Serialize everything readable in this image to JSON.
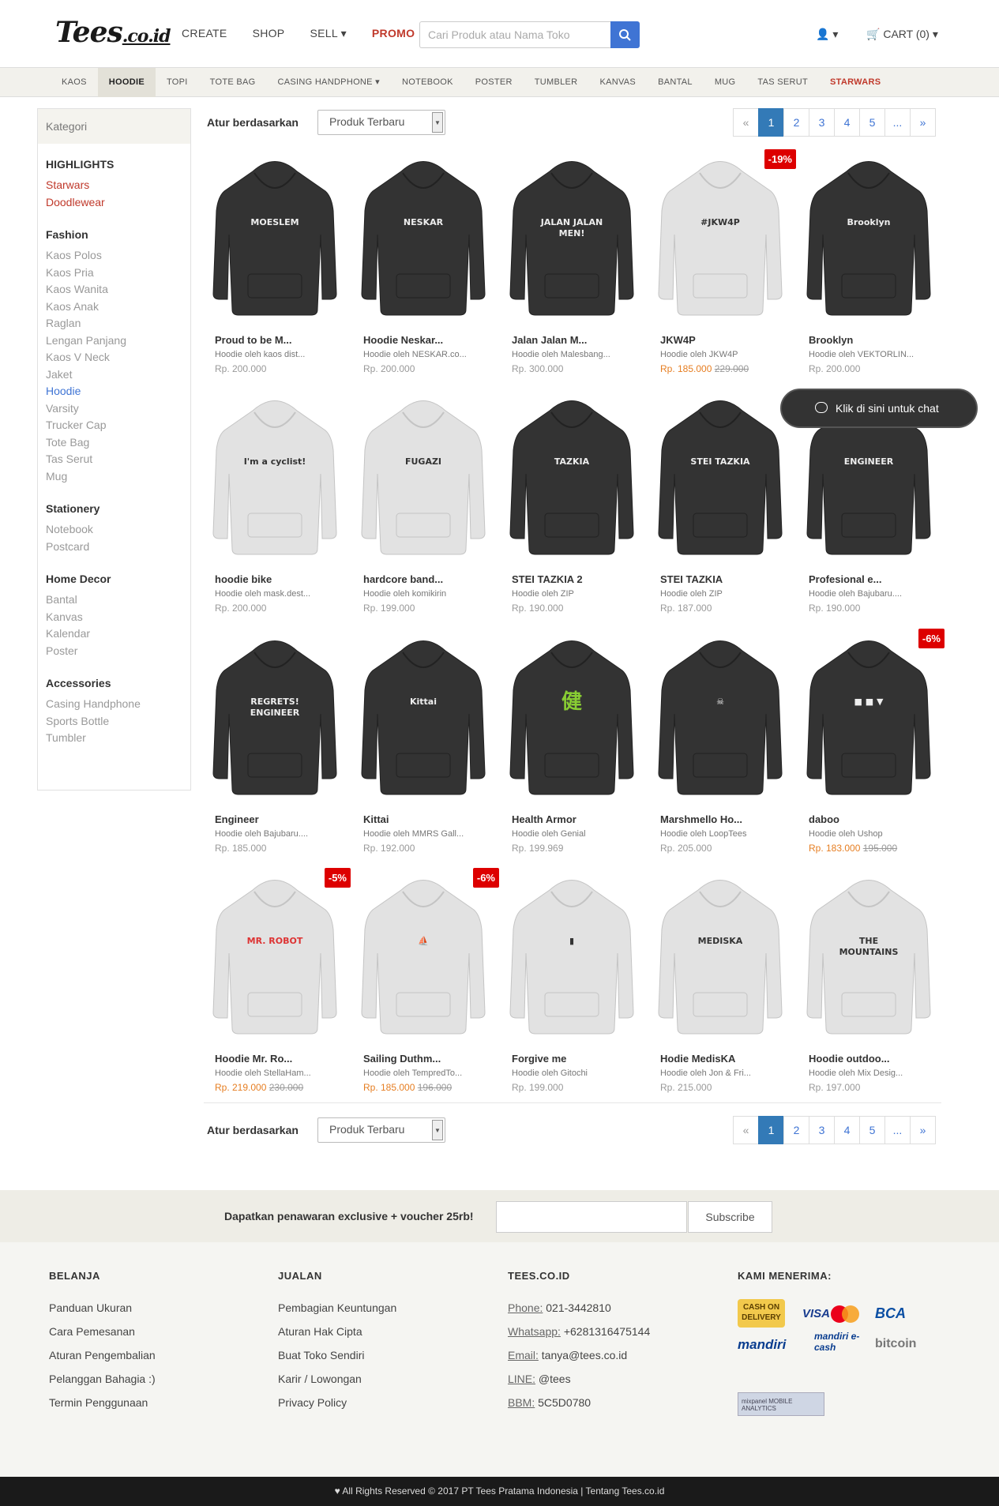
{
  "header": {
    "logo": "Tees",
    "logo_suffix": ".co.id",
    "nav": [
      "CREATE",
      "SHOP",
      "SELL",
      "PROMO"
    ],
    "search_placeholder": "Cari Produk atau Nama Toko",
    "cart": "CART (0)"
  },
  "subnav": [
    "KAOS",
    "HOODIE",
    "TOPI",
    "TOTE BAG",
    "CASING HANDPHONE",
    "NOTEBOOK",
    "POSTER",
    "TUMBLER",
    "KANVAS",
    "BANTAL",
    "MUG",
    "TAS SERUT",
    "STARWARS"
  ],
  "sidebar": {
    "title": "Kategori",
    "groups": [
      {
        "name": "HIGHLIGHTS",
        "items": [
          "Starwars",
          "Doodlewear"
        ]
      },
      {
        "name": "Fashion",
        "items": [
          "Kaos Polos",
          "Kaos Pria",
          "Kaos Wanita",
          "Kaos Anak",
          "Raglan",
          "Lengan Panjang",
          "Kaos V Neck",
          "Jaket",
          "Hoodie",
          "Varsity",
          "Trucker Cap",
          "Tote Bag",
          "Tas Serut",
          "Mug"
        ]
      },
      {
        "name": "Stationery",
        "items": [
          "Notebook",
          "Postcard"
        ]
      },
      {
        "name": "Home Decor",
        "items": [
          "Bantal",
          "Kanvas",
          "Kalendar",
          "Poster"
        ]
      },
      {
        "name": "Accessories",
        "items": [
          "Casing Handphone",
          "Sports Bottle",
          "Tumbler"
        ]
      }
    ]
  },
  "sort": {
    "label": "Atur berdasarkan",
    "value": "Produk Terbaru"
  },
  "pagination": [
    "«",
    "1",
    "2",
    "3",
    "4",
    "5",
    "...",
    "»"
  ],
  "chat": "Klik di sini untuk chat",
  "products": [
    {
      "name": "Proud to be M...",
      "seller": "Hoodie oleh kaos dist...",
      "price": "Rp. 200.000",
      "old": "",
      "badge": "",
      "color": "dark",
      "print": "MOESLEM"
    },
    {
      "name": "Hoodie Neskar...",
      "seller": "Hoodie oleh NESKAR.co...",
      "price": "Rp. 200.000",
      "old": "",
      "badge": "",
      "color": "dark",
      "print": "NESKAR"
    },
    {
      "name": "Jalan Jalan M...",
      "seller": "Hoodie oleh Malesbang...",
      "price": "Rp. 300.000",
      "old": "",
      "badge": "",
      "color": "dark",
      "print": "JALAN JALAN MEN!"
    },
    {
      "name": "JKW4P",
      "seller": "Hoodie oleh JKW4P",
      "price": "Rp. 185.000",
      "old": "229.000",
      "badge": "-19%",
      "color": "light",
      "print": "#JKW4P"
    },
    {
      "name": "Brooklyn",
      "seller": "Hoodie oleh VEKTORLIN...",
      "price": "Rp. 200.000",
      "old": "",
      "badge": "",
      "color": "dark",
      "print": "Brooklyn"
    },
    {
      "name": "hoodie bike",
      "seller": "Hoodie oleh mask.dest...",
      "price": "Rp. 200.000",
      "old": "",
      "badge": "",
      "color": "light",
      "print": "I'm a cyclist!"
    },
    {
      "name": "hardcore band...",
      "seller": "Hoodie oleh komikirin",
      "price": "Rp. 199.000",
      "old": "",
      "badge": "",
      "color": "light",
      "print": "FUGAZI"
    },
    {
      "name": "STEI TAZKIA 2",
      "seller": "Hoodie oleh ZIP",
      "price": "Rp. 190.000",
      "old": "",
      "badge": "",
      "color": "dark",
      "print": "TAZKIA"
    },
    {
      "name": "STEI TAZKIA",
      "seller": "Hoodie oleh ZIP",
      "price": "Rp. 187.000",
      "old": "",
      "badge": "",
      "color": "dark",
      "print": "STEI TAZKIA"
    },
    {
      "name": "Profesional e...",
      "seller": "Hoodie oleh Bajubaru....",
      "price": "Rp. 190.000",
      "old": "",
      "badge": "",
      "color": "dark",
      "print": "ENGINEER"
    },
    {
      "name": "Engineer",
      "seller": "Hoodie oleh Bajubaru....",
      "price": "Rp. 185.000",
      "old": "",
      "badge": "",
      "color": "dark",
      "print": "REGRETS! ENGINEER"
    },
    {
      "name": "Kittai",
      "seller": "Hoodie oleh MMRS Gall...",
      "price": "Rp. 192.000",
      "old": "",
      "badge": "",
      "color": "dark",
      "print": "Kittai"
    },
    {
      "name": "Health Armor",
      "seller": "Hoodie oleh Genial",
      "price": "Rp. 199.969",
      "old": "",
      "badge": "",
      "color": "dark",
      "print": "健"
    },
    {
      "name": "Marshmello Ho...",
      "seller": "Hoodie oleh LoopTees",
      "price": "Rp. 205.000",
      "old": "",
      "badge": "",
      "color": "dark",
      "print": "☠"
    },
    {
      "name": "daboo",
      "seller": "Hoodie oleh Ushop",
      "price": "Rp. 183.000",
      "old": "195.000",
      "badge": "-6%",
      "color": "dark",
      "print": "■ ■ ▼"
    },
    {
      "name": "Hoodie Mr. Ro...",
      "seller": "Hoodie oleh StellaHam...",
      "price": "Rp. 219.000",
      "old": "230.000",
      "badge": "-5%",
      "color": "light",
      "print": "MR. ROBOT"
    },
    {
      "name": "Sailing Duthm...",
      "seller": "Hoodie oleh TempredTo...",
      "price": "Rp. 185.000",
      "old": "196.000",
      "badge": "-6%",
      "color": "light",
      "print": "⛵"
    },
    {
      "name": "Forgive me",
      "seller": "Hoodie oleh Gitochi",
      "price": "Rp. 199.000",
      "old": "",
      "badge": "",
      "color": "light",
      "print": "▮"
    },
    {
      "name": "Hodie MedisKA",
      "seller": "Hoodie oleh Jon & Fri...",
      "price": "Rp. 215.000",
      "old": "",
      "badge": "",
      "color": "light",
      "print": "MEDISKA"
    },
    {
      "name": "Hoodie outdoo...",
      "seller": "Hoodie oleh Mix Desig...",
      "price": "Rp. 197.000",
      "old": "",
      "badge": "",
      "color": "light",
      "print": "THE MOUNTAINS"
    }
  ],
  "newsletter": {
    "text": "Dapatkan penawaran exclusive + voucher 25rb!",
    "button": "Subscribe"
  },
  "footer": {
    "belanja": {
      "title": "BELANJA",
      "links": [
        "Panduan Ukuran",
        "Cara Pemesanan",
        "Aturan Pengembalian",
        "Pelanggan Bahagia :)",
        "Termin Penggunaan"
      ]
    },
    "jualan": {
      "title": "JUALAN",
      "links": [
        "Pembagian Keuntungan",
        "Aturan Hak Cipta",
        "Buat Toko Sendiri",
        "Karir / Lowongan",
        "Privacy Policy"
      ]
    },
    "tees": {
      "title": "TEES.CO.ID",
      "contacts": [
        {
          "k": "Phone:",
          "v": "021-3442810"
        },
        {
          "k": "Whatsapp:",
          "v": "+6281316475144"
        },
        {
          "k": "Email:",
          "v": "tanya@tees.co.id"
        },
        {
          "k": "LINE:",
          "v": "@tees"
        },
        {
          "k": "BBM:",
          "v": "5C5D0780"
        }
      ]
    },
    "pay": {
      "title": "KAMI MENERIMA:",
      "logos": [
        "CASH ON DELIVERY",
        "VISA",
        "BCA",
        "mandiri",
        "mandiri e-cash",
        "bitcoin",
        "mixpanel MOBILE ANALYTICS"
      ]
    }
  },
  "copyright": "All Rights Reserved © 2017 PT Tees Pratama Indonesia | Tentang Tees.co.id"
}
